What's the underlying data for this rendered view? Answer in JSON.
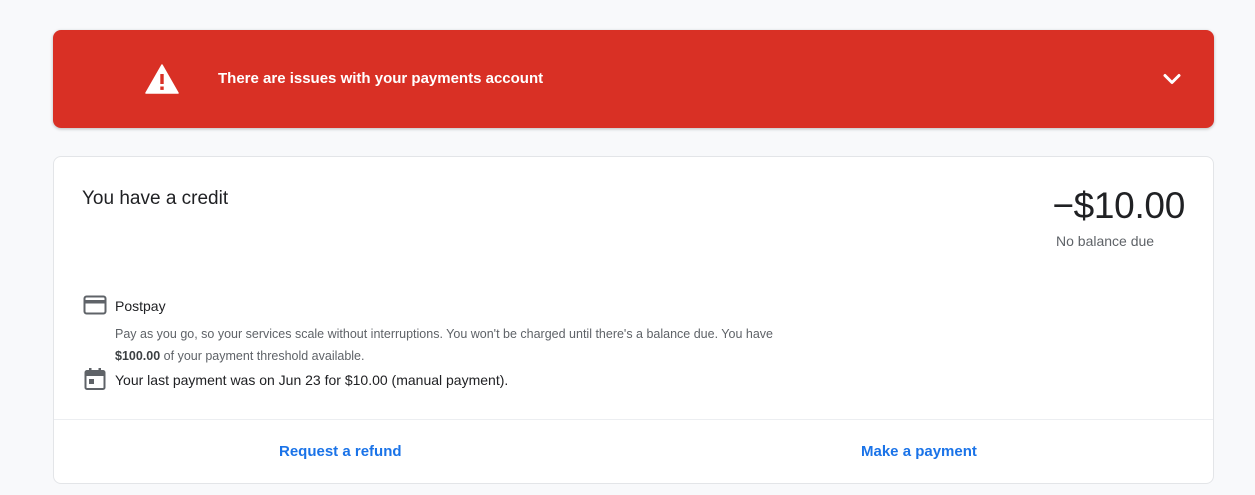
{
  "alert": {
    "message": "There are issues with your payments account",
    "icon": "warning-icon",
    "expand_icon": "chevron-down-icon",
    "background_color": "#d93025"
  },
  "summary": {
    "title": "You have a credit",
    "amount": "−$10.00",
    "amount_subtitle": "No balance due"
  },
  "payment_method": {
    "icon": "credit-card-icon",
    "label": "Postpay",
    "description_before": "Pay as you go, so your services scale without interruptions. You won't be charged until there's a balance due. You have",
    "threshold_amount": "$100.00",
    "description_after": "of your payment threshold available."
  },
  "last_payment": {
    "icon": "calendar-icon",
    "text": "Your last payment was on Jun 23 for $10.00 (manual payment)."
  },
  "actions": {
    "refund_label": "Request a refund",
    "payment_label": "Make a payment",
    "link_color": "#1a73e8"
  }
}
